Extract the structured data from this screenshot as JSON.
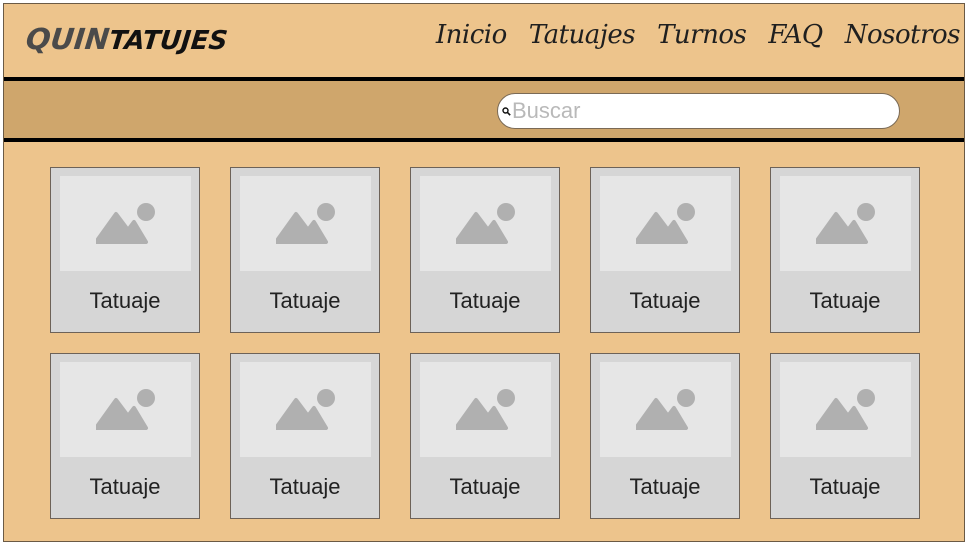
{
  "header": {
    "logo_part1": "QUIN",
    "logo_part2": "TATUJES",
    "nav": [
      {
        "label": "Inicio"
      },
      {
        "label": "Tatuajes"
      },
      {
        "label": "Turnos"
      },
      {
        "label": "FAQ"
      },
      {
        "label": "Nosotros"
      }
    ]
  },
  "search": {
    "placeholder": "Buscar",
    "value": "",
    "icon": "search-icon"
  },
  "gallery": {
    "items": [
      {
        "label": "Tatuaje",
        "icon": "image-placeholder-icon"
      },
      {
        "label": "Tatuaje",
        "icon": "image-placeholder-icon"
      },
      {
        "label": "Tatuaje",
        "icon": "image-placeholder-icon"
      },
      {
        "label": "Tatuaje",
        "icon": "image-placeholder-icon"
      },
      {
        "label": "Tatuaje",
        "icon": "image-placeholder-icon"
      },
      {
        "label": "Tatuaje",
        "icon": "image-placeholder-icon"
      },
      {
        "label": "Tatuaje",
        "icon": "image-placeholder-icon"
      },
      {
        "label": "Tatuaje",
        "icon": "image-placeholder-icon"
      },
      {
        "label": "Tatuaje",
        "icon": "image-placeholder-icon"
      },
      {
        "label": "Tatuaje",
        "icon": "image-placeholder-icon"
      }
    ]
  },
  "colors": {
    "page_background": "#edc48c",
    "search_band": "#cfa66c",
    "card_background": "#d6d6d6",
    "thumb_background": "#e6e6e6",
    "placeholder_icon": "#b0b0b0"
  }
}
